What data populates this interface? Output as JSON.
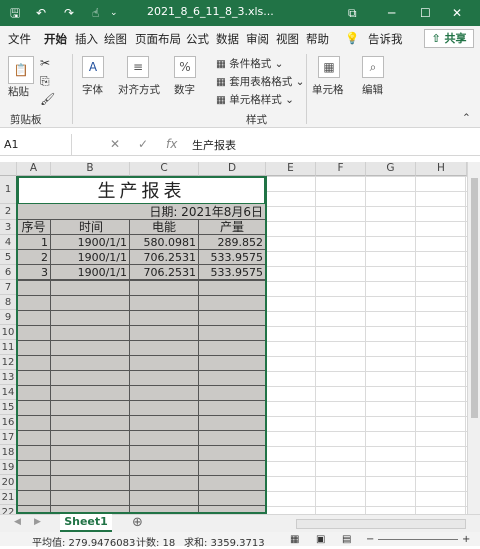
{
  "window": {
    "title": "2021_8_6_11_8_3.xls...",
    "icons": [
      "save-icon",
      "undo-icon",
      "redo-icon",
      "touch-icon",
      "dropdown-icon"
    ]
  },
  "menu": {
    "items": [
      "文件",
      "开始",
      "插入",
      "绘图",
      "页面布局",
      "公式",
      "数据",
      "审阅",
      "视图",
      "帮助"
    ],
    "active_index": 1,
    "tellme": "告诉我",
    "share": "共享"
  },
  "ribbon": {
    "paste": "粘贴",
    "clipboard": "剪贴板",
    "font": "字体",
    "align": "对齐方式",
    "number": "数字",
    "cond_format": "条件格式",
    "table_format": "套用表格格式",
    "cell_style": "单元格样式",
    "styles": "样式",
    "cells": "单元格",
    "edit": "编辑"
  },
  "formula": {
    "name": "A1",
    "content": "生产报表"
  },
  "sheet": {
    "columns": [
      "A",
      "B",
      "C",
      "D",
      "E",
      "F",
      "G",
      "H"
    ],
    "rows": [
      "1",
      "2",
      "3",
      "4",
      "5",
      "6",
      "7",
      "8",
      "9",
      "10",
      "11",
      "12",
      "13",
      "14",
      "15",
      "16",
      "17",
      "18",
      "19",
      "20",
      "21",
      "22"
    ],
    "report_title": "生产报表",
    "report_date": "日期: 2021年8月6日",
    "headers": [
      "序号",
      "时间",
      "电能",
      "产量"
    ],
    "data": [
      [
        "1",
        "1900/1/1",
        "580.0981",
        "289.852"
      ],
      [
        "2",
        "1900/1/1",
        "706.2531",
        "533.9575"
      ],
      [
        "3",
        "1900/1/1",
        "706.2531",
        "533.9575"
      ]
    ],
    "tab": "Sheet1"
  },
  "status": {
    "avg": "平均值: 279.9476083",
    "count": "计数: 18",
    "sum": "求和: 3359.3713"
  },
  "colors": {
    "accent": "#217346",
    "selection_fill": "#cbc9c6"
  }
}
